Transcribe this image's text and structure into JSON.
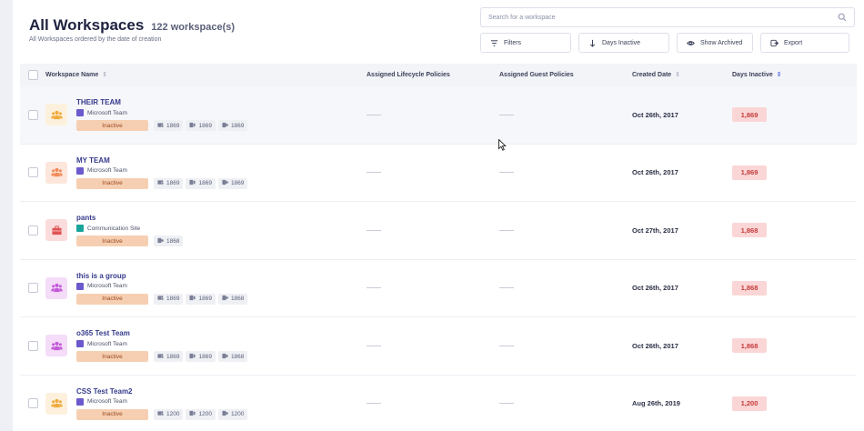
{
  "header": {
    "title": "All Workspaces",
    "count": "122 workspace(s)",
    "subtitle": "All Workspaces ordered by the date of creation"
  },
  "search": {
    "placeholder": "Search for a workspace"
  },
  "toolbar": {
    "filters": "Filters",
    "days_inactive": "Days Inactive",
    "show_archived": "Show Archived",
    "export": "Export"
  },
  "table": {
    "headers": {
      "name": "Workspace Name",
      "lifecycle": "Assigned Lifecycle Policies",
      "guest": "Assigned Guest Policies",
      "created": "Created Date",
      "days": "Days Inactive"
    },
    "rows": [
      {
        "name": "THEIR TEAM",
        "type": "Microsoft Team",
        "status": "Inactive",
        "stats": [
          "1869",
          "1869",
          "1869"
        ],
        "lifecycle": "—",
        "guest": "—",
        "created": "Oct 26th, 2017",
        "days": "1,869",
        "icon_color": "#f0a93a",
        "icon_bg": "#fdf1dd",
        "type_color": "#6a5acd"
      },
      {
        "name": "MY TEAM",
        "type": "Microsoft Team",
        "status": "Inactive",
        "stats": [
          "1869",
          "1869",
          "1869"
        ],
        "lifecycle": "—",
        "guest": "—",
        "created": "Oct 26th, 2017",
        "days": "1,869",
        "icon_color": "#f08a5a",
        "icon_bg": "#fde6db",
        "type_color": "#6a5acd"
      },
      {
        "name": "pants",
        "type": "Communication Site",
        "status": "Inactive",
        "stats": [
          "1868"
        ],
        "lifecycle": "—",
        "guest": "—",
        "created": "Oct 27th, 2017",
        "days": "1,868",
        "icon_color": "#e05555",
        "icon_bg": "#fbdcdc",
        "type_color": "#1aa39a"
      },
      {
        "name": "this is a group",
        "type": "Microsoft Team",
        "status": "Inactive",
        "stats": [
          "1869",
          "1869",
          "1868"
        ],
        "lifecycle": "—",
        "guest": "—",
        "created": "Oct 26th, 2017",
        "days": "1,868",
        "icon_color": "#c25ad8",
        "icon_bg": "#f5dcf9",
        "type_color": "#6a5acd"
      },
      {
        "name": "o365 Test Team",
        "type": "Microsoft Team",
        "status": "Inactive",
        "stats": [
          "1869",
          "1869",
          "1868"
        ],
        "lifecycle": "—",
        "guest": "—",
        "created": "Oct 26th, 2017",
        "days": "1,868",
        "icon_color": "#c25ad8",
        "icon_bg": "#f5dcf9",
        "type_color": "#6a5acd"
      },
      {
        "name": "CSS Test Team2",
        "type": "Microsoft Team",
        "status": "Inactive",
        "stats": [
          "1200",
          "1200",
          "1200"
        ],
        "lifecycle": "—",
        "guest": "—",
        "created": "Aug 26th, 2019",
        "days": "1,200",
        "icon_color": "#f0a93a",
        "icon_bg": "#fdf1dd",
        "type_color": "#6a5acd"
      }
    ]
  }
}
